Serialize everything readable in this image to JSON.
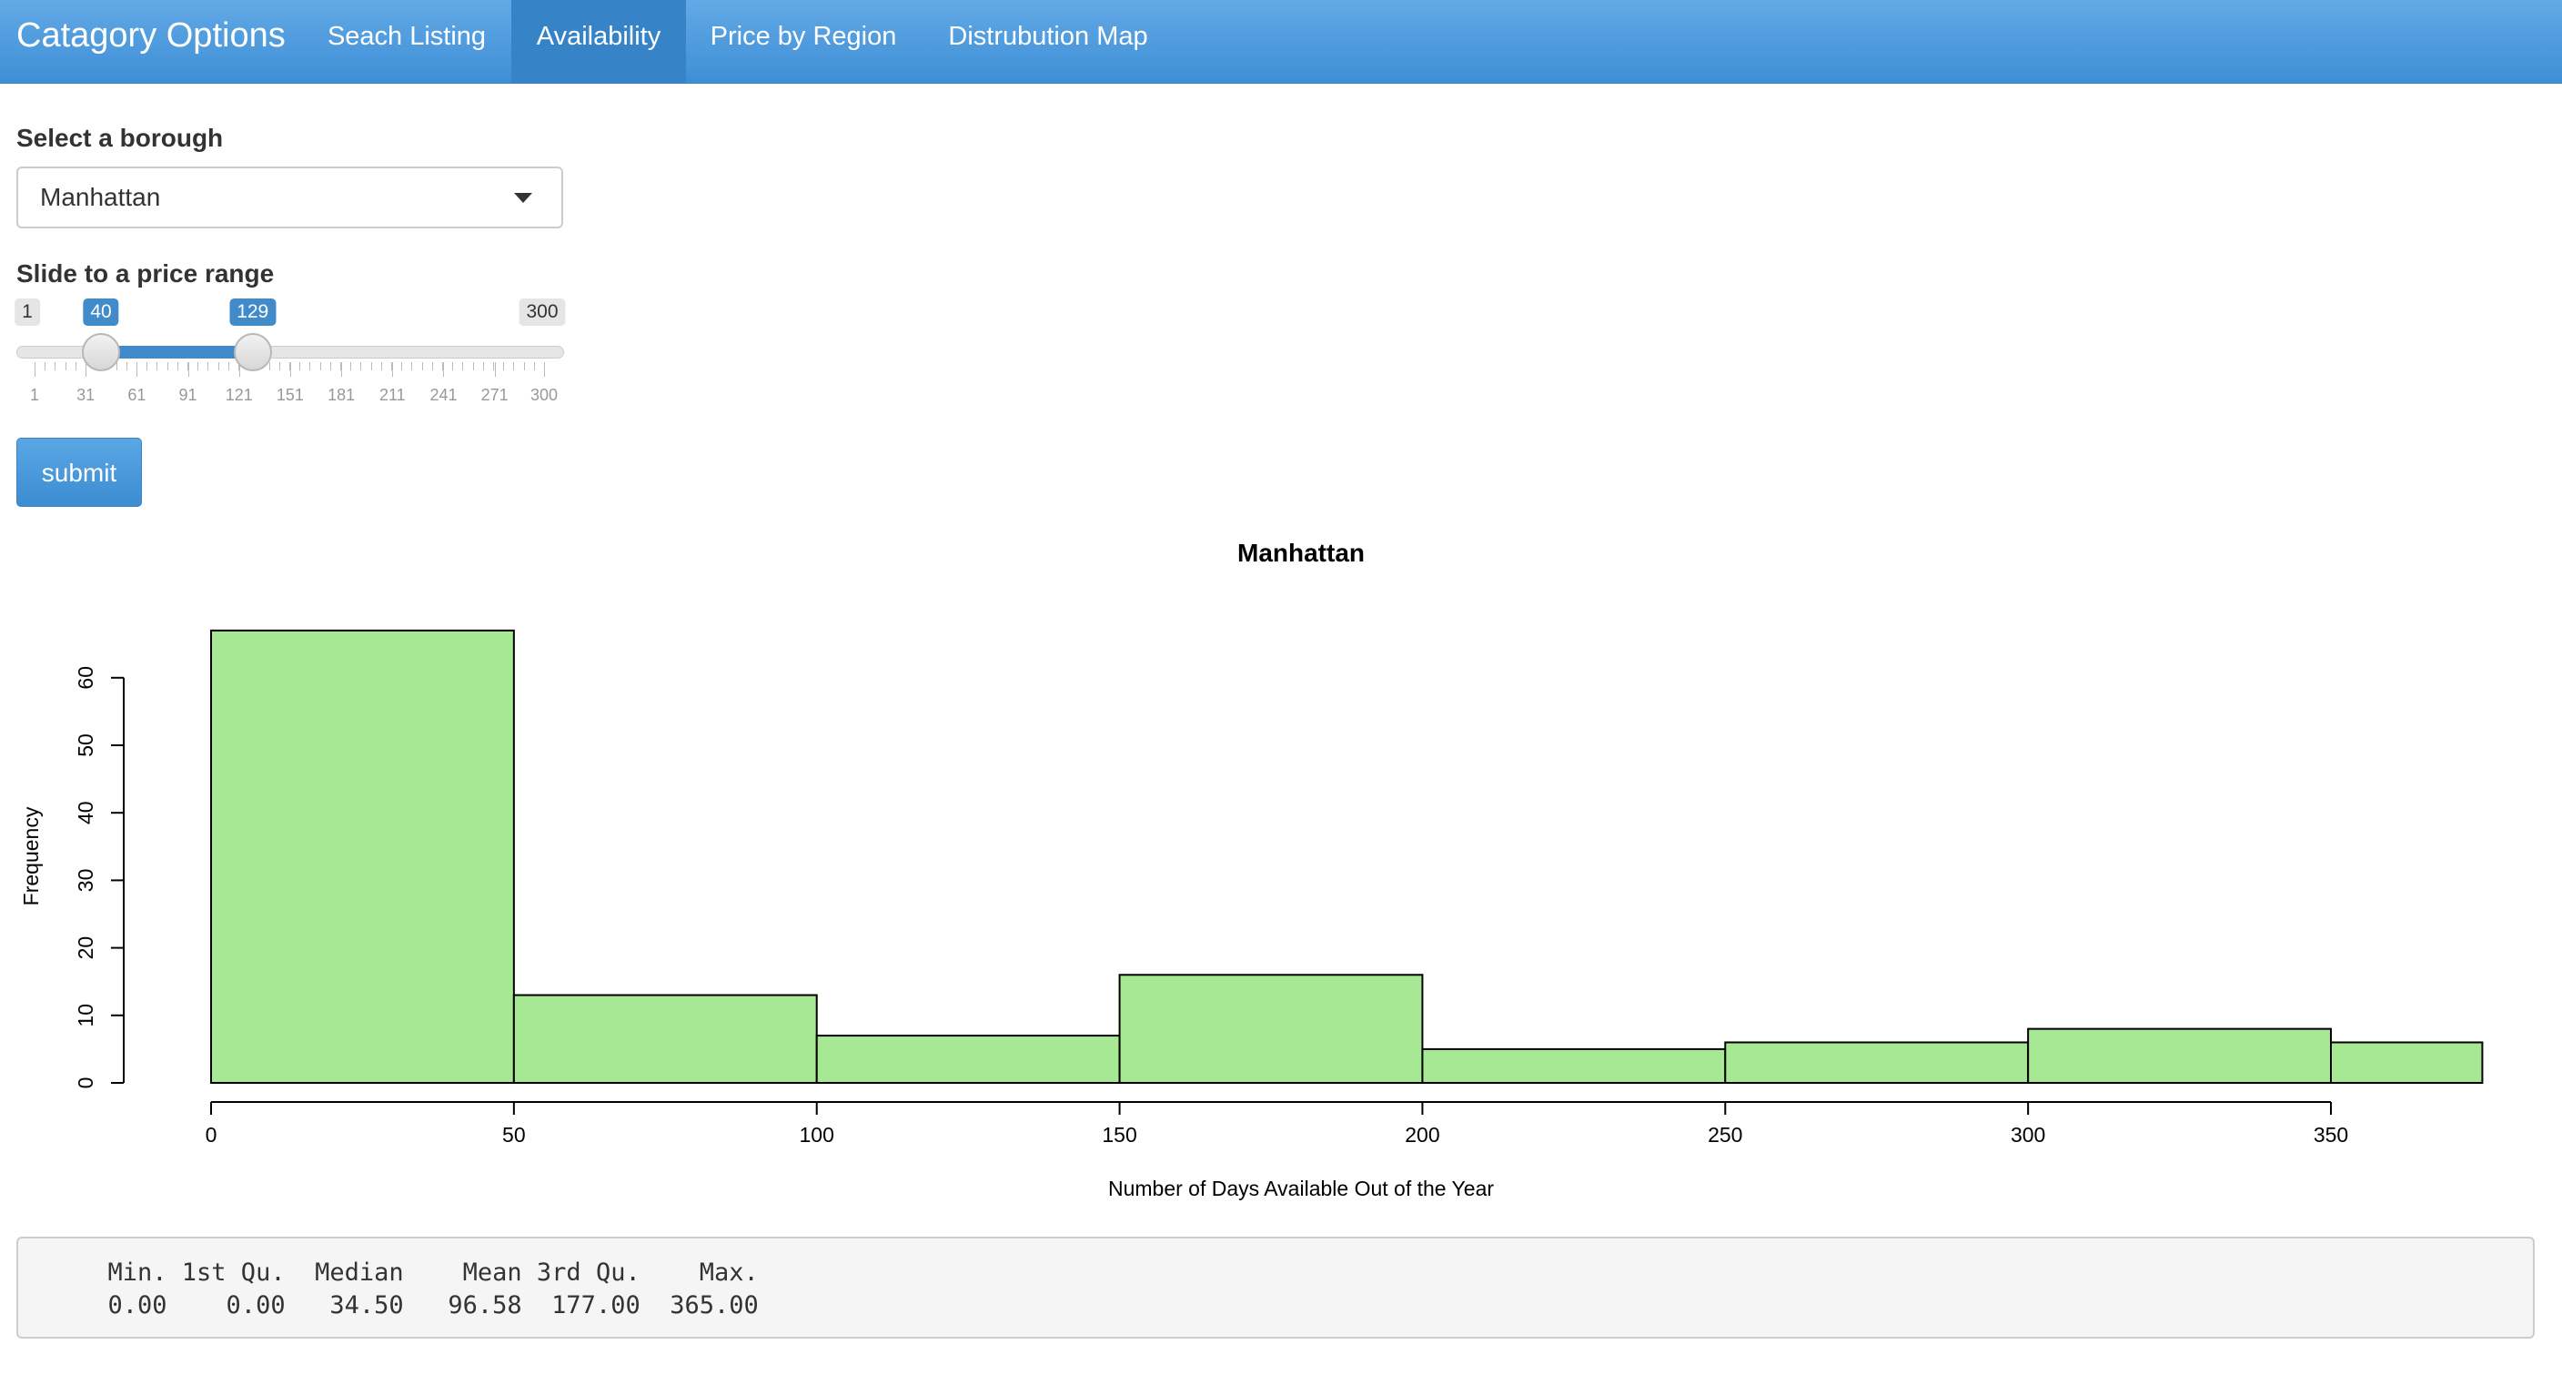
{
  "navbar": {
    "brand": "Catagory Options",
    "tabs": [
      {
        "label": "Seach Listing",
        "active": false
      },
      {
        "label": "Availability",
        "active": true
      },
      {
        "label": "Price by Region",
        "active": false
      },
      {
        "label": "Distrubution Map",
        "active": false
      }
    ]
  },
  "controls": {
    "borough_label": "Select a borough",
    "borough_value": "Manhattan",
    "price_label": "Slide to a price range",
    "slider": {
      "min": 1,
      "max": 300,
      "from": 40,
      "to": 129,
      "ticks": [
        1,
        31,
        61,
        91,
        121,
        151,
        181,
        211,
        241,
        271,
        300
      ]
    },
    "submit_label": "submit"
  },
  "chart_data": {
    "type": "bar",
    "title": "Manhattan",
    "xlabel": "Number of Days Available Out of the Year",
    "ylabel": "Frequency",
    "bins": [
      {
        "start": 0,
        "end": 50,
        "count": 67
      },
      {
        "start": 50,
        "end": 100,
        "count": 13
      },
      {
        "start": 100,
        "end": 150,
        "count": 7
      },
      {
        "start": 150,
        "end": 200,
        "count": 16
      },
      {
        "start": 200,
        "end": 250,
        "count": 5
      },
      {
        "start": 250,
        "end": 300,
        "count": 6
      },
      {
        "start": 300,
        "end": 350,
        "count": 8
      },
      {
        "start": 350,
        "end": 375,
        "count": 6
      }
    ],
    "xlim": [
      0,
      375
    ],
    "ylim": [
      0,
      67
    ],
    "xticks": [
      0,
      50,
      100,
      150,
      200,
      250,
      300,
      350
    ],
    "yticks": [
      0,
      10,
      20,
      30,
      40,
      50,
      60
    ],
    "bar_color": "#a6e893",
    "grid": false
  },
  "summary": {
    "header": "  Min. 1st Qu.  Median    Mean 3rd Qu.    Max. ",
    "values": "  0.00    0.00   34.50   96.58  177.00  365.00 "
  }
}
